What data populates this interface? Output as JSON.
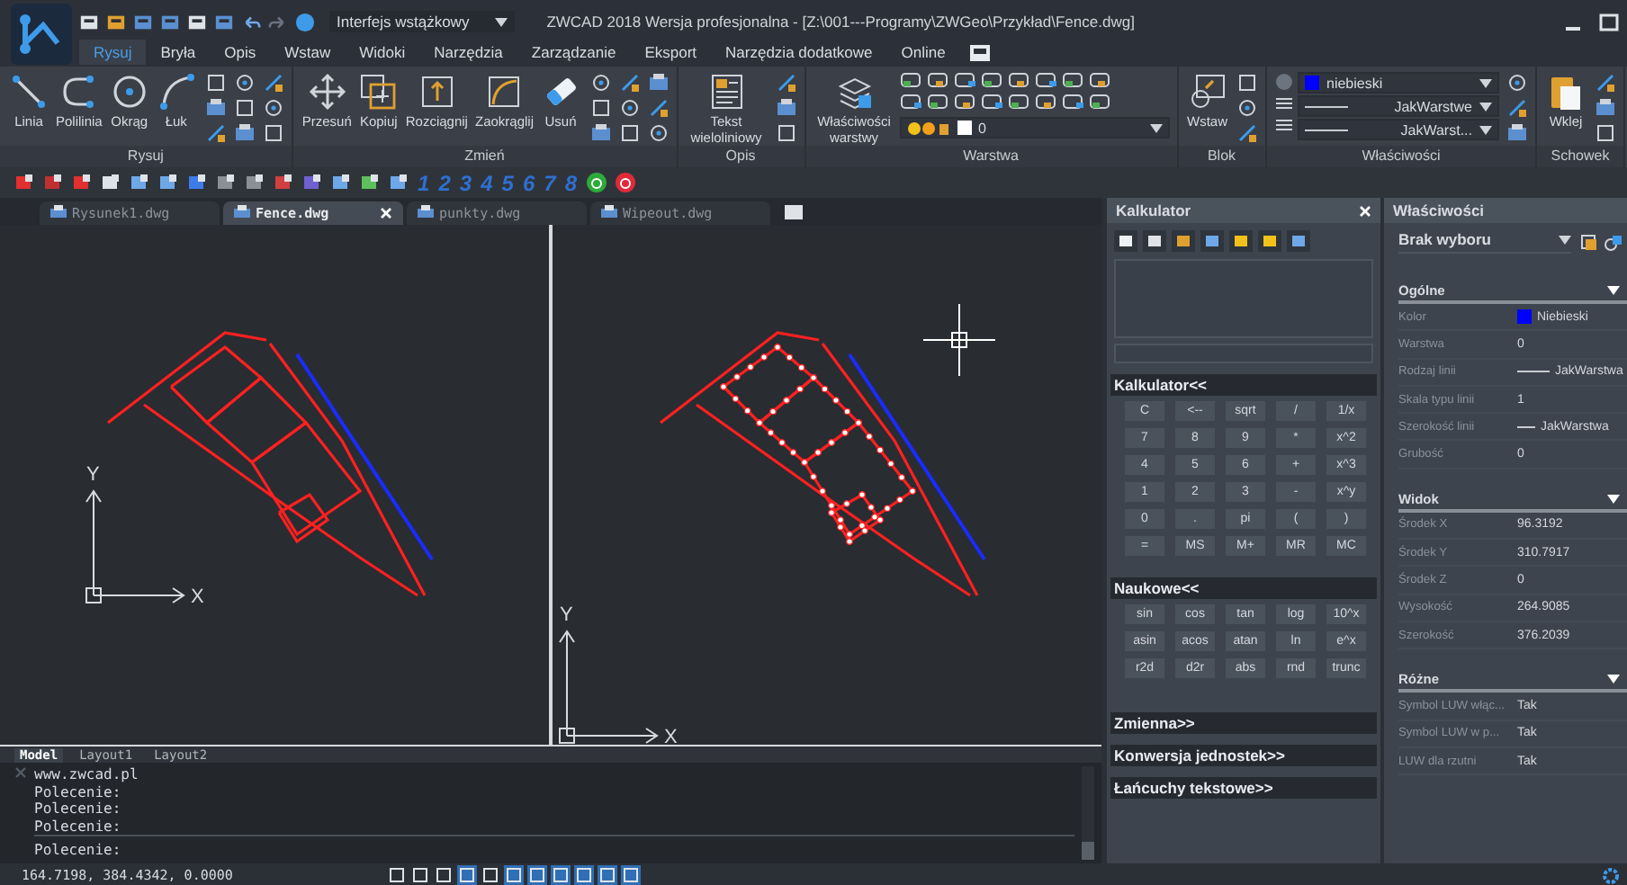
{
  "title_bar": {
    "workspace": "Interfejs wstążkowy",
    "title": "ZWCAD 2018 Wersja profesjonalna - [Z:\\001---Programy\\ZWGeo\\Przykład\\Fence.dwg]"
  },
  "menu_tabs": [
    {
      "label": "Rysuj",
      "selected": true
    },
    {
      "label": "Bryła",
      "selected": false
    },
    {
      "label": "Opis",
      "selected": false
    },
    {
      "label": "Wstaw",
      "selected": false
    },
    {
      "label": "Widoki",
      "selected": false
    },
    {
      "label": "Narzędzia",
      "selected": false
    },
    {
      "label": "Zarządzanie",
      "selected": false
    },
    {
      "label": "Eksport",
      "selected": false
    },
    {
      "label": "Narzędzia dodatkowe",
      "selected": false
    },
    {
      "label": "Online",
      "selected": false
    }
  ],
  "ribbon": [
    {
      "title": "Rysuj",
      "tools": [
        {
          "label": "Linia",
          "kind": "line"
        },
        {
          "label": "Polilinia",
          "kind": "polyline"
        },
        {
          "label": "Okrąg",
          "kind": "circle"
        },
        {
          "label": "Łuk",
          "kind": "arc"
        }
      ]
    },
    {
      "title": "Zmień",
      "tools": [
        {
          "label": "Przesuń",
          "kind": "move"
        },
        {
          "label": "Kopiuj",
          "kind": "copy"
        },
        {
          "label": "Rozciągnij",
          "kind": "stretch"
        },
        {
          "label": "Zaokrąglij",
          "kind": "fillet"
        },
        {
          "label": "Usuń",
          "kind": "eraser"
        }
      ]
    },
    {
      "title": "Opis",
      "tools": [
        {
          "label": "Tekst wieloliniowy",
          "kind": "text"
        }
      ]
    },
    {
      "title": "Warstwa",
      "tools": [
        {
          "label": "Właściwości warstwy",
          "kind": "layers"
        }
      ],
      "layer": "0"
    },
    {
      "title": "Blok",
      "tools": [
        {
          "label": "Wstaw",
          "kind": "insert"
        }
      ]
    },
    {
      "title": "Właściwości",
      "combos": [
        {
          "value": "niebieski",
          "color": "#0000ff"
        },
        {
          "value": "JakWarstwe"
        },
        {
          "value": "JakWarst..."
        }
      ]
    },
    {
      "title": "Schowek",
      "tools": [
        {
          "label": "Wklej",
          "kind": "paste"
        }
      ]
    }
  ],
  "toolbar_numbers": [
    "1",
    "2",
    "3",
    "4",
    "5",
    "6",
    "7",
    "8"
  ],
  "document_tabs": [
    {
      "label": "Rysunek1.dwg",
      "selected": false
    },
    {
      "label": "Fence.dwg",
      "selected": true
    },
    {
      "label": "punkty.dwg",
      "selected": false
    },
    {
      "label": "Wipeout.dwg",
      "selected": false
    }
  ],
  "viewports": [
    {
      "axis_x": "X",
      "axis_y": "Y",
      "grips": false,
      "cursor": false
    },
    {
      "axis_x": "X",
      "axis_y": "Y",
      "grips": true,
      "cursor": true
    }
  ],
  "layout_tabs": [
    {
      "label": "Model",
      "selected": true
    },
    {
      "label": "Layout1",
      "selected": false
    },
    {
      "label": "Layout2",
      "selected": false
    }
  ],
  "command": {
    "history": [
      "www.zwcad.pl",
      "Polecenie:",
      "Polecenie:",
      "Polecenie:"
    ],
    "prompt": "Polecenie:"
  },
  "calculator": {
    "title": "Kalkulator",
    "basic_title": "Kalkulator<<",
    "basic_keys": [
      "C",
      "<--",
      "sqrt",
      "/",
      "1/x",
      "7",
      "8",
      "9",
      "*",
      "x^2",
      "4",
      "5",
      "6",
      "+",
      "x^3",
      "1",
      "2",
      "3",
      "-",
      "x^y",
      "0",
      ".",
      "pi",
      "(",
      ")",
      "=",
      "MS",
      "M+",
      "MR",
      "MC"
    ],
    "scientific_title": "Naukowe<<",
    "scientific_keys": [
      "sin",
      "cos",
      "tan",
      "log",
      "10^x",
      "asin",
      "acos",
      "atan",
      "ln",
      "e^x",
      "r2d",
      "d2r",
      "abs",
      "rnd",
      "trunc"
    ],
    "sections": [
      "Zmienna>>",
      "Konwersja jednostek>>",
      "Łańcuchy tekstowe>>"
    ]
  },
  "properties": {
    "title": "Właściwości",
    "selection": "Brak wyboru",
    "groups": [
      {
        "title": "Ogólne",
        "rows": [
          {
            "label": "Kolor",
            "value": "Niebieski",
            "kind": "color",
            "color": "#0000ff"
          },
          {
            "label": "Warstwa",
            "value": "0",
            "kind": "text"
          },
          {
            "label": "Rodzaj linii",
            "value": "JakWarstwa",
            "kind": "line"
          },
          {
            "label": "Skala typu linii",
            "value": "1",
            "kind": "text"
          },
          {
            "label": "Szerokość linii",
            "value": "JakWarstwa",
            "kind": "shortline"
          },
          {
            "label": "Grubość",
            "value": "0",
            "kind": "text"
          }
        ]
      },
      {
        "title": "Widok",
        "rows": [
          {
            "label": "Środek X",
            "value": "96.3192",
            "kind": "text"
          },
          {
            "label": "Środek Y",
            "value": "310.7917",
            "kind": "text"
          },
          {
            "label": "Środek Z",
            "value": "0",
            "kind": "text"
          },
          {
            "label": "Wysokość",
            "value": "264.9085",
            "kind": "text"
          },
          {
            "label": "Szerokość",
            "value": "376.2039",
            "kind": "text"
          }
        ]
      },
      {
        "title": "Różne",
        "rows": [
          {
            "label": "Symbol LUW włąc...",
            "value": "Tak",
            "kind": "text"
          },
          {
            "label": "Symbol LUW w p...",
            "value": "Tak",
            "kind": "text"
          },
          {
            "label": "LUW dla rzutni",
            "value": "Tak",
            "kind": "text"
          }
        ]
      }
    ]
  },
  "status_bar": {
    "coordinates": "164.7198, 384.4342, 0.0000",
    "toggles": [
      {
        "on": false
      },
      {
        "on": false
      },
      {
        "on": false
      },
      {
        "on": true
      },
      {
        "on": false
      },
      {
        "on": true
      },
      {
        "on": true
      },
      {
        "on": true
      },
      {
        "on": true
      },
      {
        "on": true
      },
      {
        "on": true
      }
    ]
  }
}
